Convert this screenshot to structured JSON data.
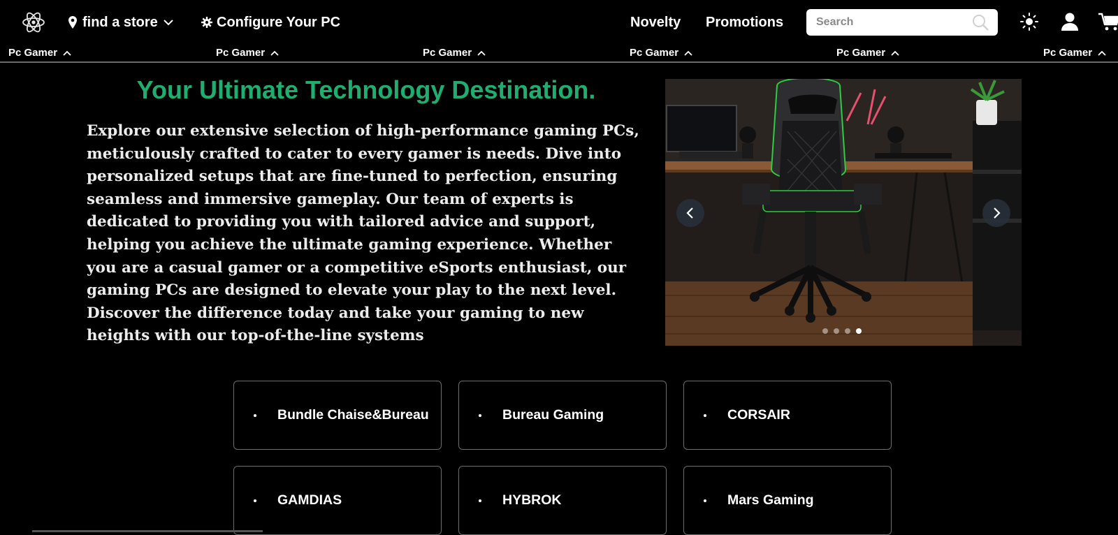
{
  "header": {
    "find_store_label": "find a store",
    "configure_label": "Configure Your PC",
    "nav": {
      "novelty": "Novelty",
      "promotions": "Promotions"
    },
    "search": {
      "placeholder": "Search",
      "value": ""
    },
    "icons": [
      "atom-logo-icon",
      "map-pin-icon",
      "chevron-down-icon",
      "gear-icon",
      "search-icon",
      "sun-icon",
      "user-icon",
      "cart-icon"
    ]
  },
  "categories": [
    {
      "label": "Pc Gamer"
    },
    {
      "label": "Pc Gamer"
    },
    {
      "label": "Pc Gamer"
    },
    {
      "label": "Pc Gamer"
    },
    {
      "label": "Pc Gamer"
    },
    {
      "label": "Pc Gamer"
    }
  ],
  "hero": {
    "title": "Your Ultimate Technology Destination.",
    "body": "Explore our extensive selection of high-performance gaming PCs, meticulously crafted to cater to every gamer is needs. Dive into personalized setups that are fine-tuned to perfection, ensuring seamless and immersive gameplay. Our team of experts is dedicated to providing you with tailored advice and support, helping you achieve the ultimate gaming experience. Whether you are a casual gamer or a competitive eSports enthusiast, our gaming PCs are designed to elevate your play to the next level. Discover the difference today and take your gaming to new heights with our top-of-the-line systems"
  },
  "carousel": {
    "slide_count": 4,
    "active_slide": 4,
    "colors": {
      "title_green": "#1fae6f",
      "chair_accent": "#2ecc40"
    }
  },
  "brands": [
    {
      "label": "Bundle Chaise&Bureau"
    },
    {
      "label": "Bureau Gaming"
    },
    {
      "label": "CORSAIR"
    },
    {
      "label": "GAMDIAS"
    },
    {
      "label": "HYBROK"
    },
    {
      "label": "Mars Gaming"
    }
  ]
}
